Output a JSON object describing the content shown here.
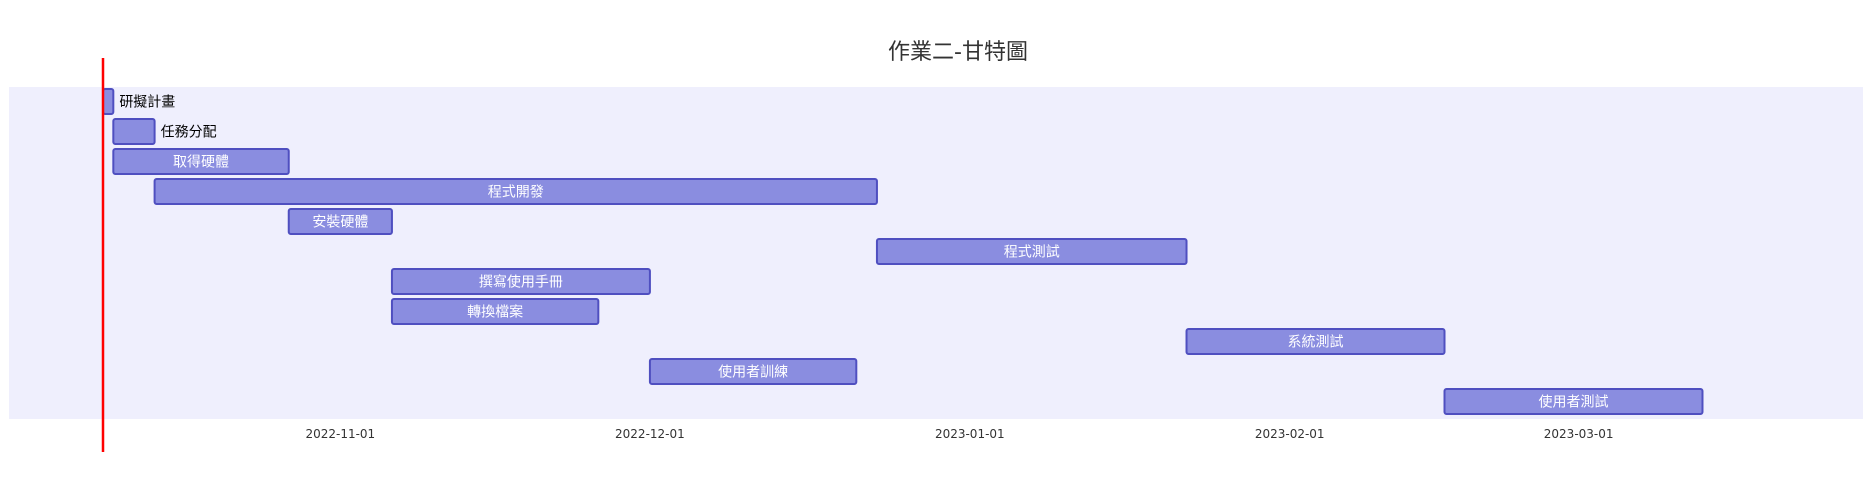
{
  "chart_data": {
    "type": "gantt",
    "title": "作業二-甘特圖",
    "x_axis": {
      "type": "date",
      "domain": [
        "2022-10-09",
        "2023-03-24"
      ],
      "ticks": [
        "2022-11-01",
        "2022-12-01",
        "2023-01-01",
        "2023-02-01",
        "2023-03-01"
      ]
    },
    "today_marker": "2022-10-09",
    "tasks": [
      {
        "name": "研擬計畫",
        "start": "2022-10-09",
        "end": "2022-10-10"
      },
      {
        "name": "任務分配",
        "start": "2022-10-10",
        "end": "2022-10-14"
      },
      {
        "name": "取得硬體",
        "start": "2022-10-10",
        "end": "2022-10-27"
      },
      {
        "name": "程式開發",
        "start": "2022-10-14",
        "end": "2022-12-23"
      },
      {
        "name": "安裝硬體",
        "start": "2022-10-27",
        "end": "2022-11-06"
      },
      {
        "name": "程式測試",
        "start": "2022-12-23",
        "end": "2023-01-22"
      },
      {
        "name": "撰寫使用手冊",
        "start": "2022-11-06",
        "end": "2022-12-01"
      },
      {
        "name": "轉換檔案",
        "start": "2022-11-06",
        "end": "2022-11-26"
      },
      {
        "name": "系統測試",
        "start": "2023-01-22",
        "end": "2023-02-16"
      },
      {
        "name": "使用者訓練",
        "start": "2022-12-01",
        "end": "2022-12-21"
      },
      {
        "name": "使用者測試",
        "start": "2023-02-16",
        "end": "2023-03-13"
      }
    ],
    "colors": {
      "background": "#efeffd",
      "bar_fill": "#8a8de0",
      "bar_stroke": "#4f4fc0",
      "today_line": "#ff0000",
      "label_inside": "#ffffff",
      "label_outside": "#000000"
    },
    "grid": false,
    "legend": "none"
  }
}
